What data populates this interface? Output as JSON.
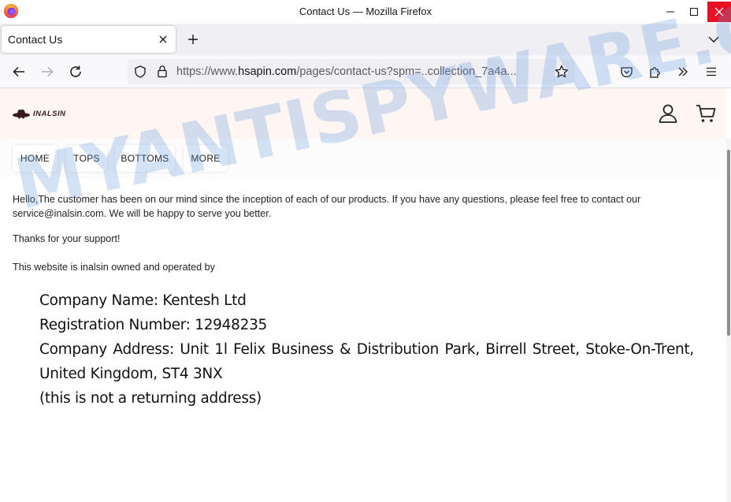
{
  "window": {
    "title": "Contact Us — Mozilla Firefox"
  },
  "tab": {
    "title": "Contact Us"
  },
  "urlbar": {
    "scheme": "https://www.",
    "host": "hsapin.com",
    "path": "/pages/contact-us?spm=..collection_7a4a..."
  },
  "site": {
    "brand": "INALSIN",
    "nav": [
      "HOME",
      "TOPS",
      "BOTTOMS",
      "MORE"
    ]
  },
  "content": {
    "p1": "Hello,The customer has been on our mind since the inception of each of our products. If you have any questions, please feel free to contact our service@inalsin.com. We will be happy to serve you better.",
    "p2": "Thanks for your support!",
    "p3": "This website is inalsin owned and operated by",
    "company_name": "Company Name: Kentesh Ltd",
    "registration": "Registration Number: 12948235",
    "address": "Company Address: Unit 1l Felix Business & Distribution Park, Birrell Street, Stoke-On-Trent, United Kingdom, ST4 3NX",
    "note": "(this is not a returning address)"
  },
  "watermark": "MYANTISPYWARE.COM",
  "colors": {
    "close_red": "#e81123",
    "header_bg": "#fdf6f3",
    "watermark": "#6496dc"
  }
}
